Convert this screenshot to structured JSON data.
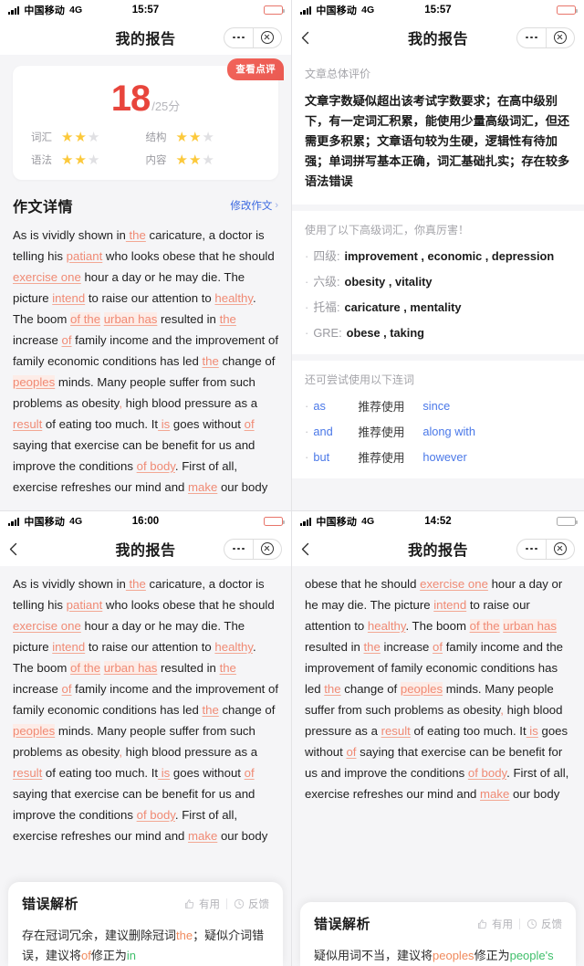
{
  "colors": {
    "accent_red": "#e8453c",
    "badge_red": "#ea5a52",
    "error_orange": "#f08a74",
    "link_blue": "#3d6ae0",
    "conj_blue": "#4a78e8",
    "star_gold": "#fcc93b",
    "suggest_green": "#3fbf6b",
    "page_bg": "#f5f5f7"
  },
  "status_bars": [
    {
      "carrier": "中国移动",
      "network": "4G",
      "time": "15:57",
      "battery_level": 62,
      "battery_low": true
    },
    {
      "carrier": "中国移动",
      "network": "4G",
      "time": "15:57",
      "battery_level": 62,
      "battery_low": true
    },
    {
      "carrier": "中国移动",
      "network": "4G",
      "time": "16:00",
      "battery_level": 55,
      "battery_low": true
    },
    {
      "carrier": "中国移动",
      "network": "4G",
      "time": "14:52",
      "battery_level": 45,
      "battery_low": false
    }
  ],
  "nav": {
    "title": "我的报告",
    "back_icon": "chevron-left-icon",
    "more_icon": "more-dots-icon",
    "close_icon": "close-circle-icon"
  },
  "score_card": {
    "badge": "查看点评",
    "score": "18",
    "total": "/25分",
    "ratings": [
      {
        "label": "词汇",
        "filled": 2,
        "max": 3
      },
      {
        "label": "结构",
        "filled": 2,
        "max": 3
      },
      {
        "label": "语法",
        "filled": 2,
        "max": 3
      },
      {
        "label": "内容",
        "filled": 2,
        "max": 3
      }
    ],
    "star_glyph": "★"
  },
  "detail": {
    "title": "作文详情",
    "modify_label": "修改作文",
    "chevron": "›"
  },
  "essay_segments_a": [
    {
      "t": "As is vividly shown in",
      "k": "n"
    },
    {
      "t": " the",
      "k": "e"
    },
    {
      "t": " caricature, a doctor is telling his ",
      "k": "n"
    },
    {
      "t": "patiant",
      "k": "e"
    },
    {
      "t": " who looks obese that he should ",
      "k": "n"
    },
    {
      "t": "exercise one",
      "k": "e"
    },
    {
      "t": " hour a day or he may die. The picture ",
      "k": "n"
    },
    {
      "t": "intend",
      "k": "e"
    },
    {
      "t": " to raise our attention to ",
      "k": "n"
    },
    {
      "t": "healthy",
      "k": "e"
    },
    {
      "t": ". The boom ",
      "k": "n"
    },
    {
      "t": "of the",
      "k": "eh"
    },
    {
      "t": " ",
      "k": "n"
    },
    {
      "t": "urban has",
      "k": "eh"
    },
    {
      "t": " resulted in ",
      "k": "n"
    },
    {
      "t": "the",
      "k": "e"
    },
    {
      "t": " increase ",
      "k": "n"
    },
    {
      "t": "of",
      "k": "e"
    },
    {
      "t": " family income and the improvement of family economic conditions has led ",
      "k": "n"
    },
    {
      "t": "the",
      "k": "e"
    },
    {
      "t": " change of ",
      "k": "n"
    },
    {
      "t": "peoples",
      "k": "eh"
    },
    {
      "t": " minds. Many people suffer from such problems as obesity",
      "k": "n"
    },
    {
      "t": ",",
      "k": "c"
    },
    {
      "t": " high blood pressure as a ",
      "k": "n"
    },
    {
      "t": "result",
      "k": "e"
    },
    {
      "t": " of eating too much. It",
      "k": "n"
    },
    {
      "t": " is",
      "k": "e"
    },
    {
      "t": " goes without ",
      "k": "n"
    },
    {
      "t": "of",
      "k": "e"
    },
    {
      "t": " saying that exercise can be benefit for us and improve the conditions ",
      "k": "n"
    },
    {
      "t": "of body",
      "k": "e"
    },
    {
      "t": ". First of all, exercise refreshes our mind and ",
      "k": "n"
    },
    {
      "t": "make",
      "k": "e"
    },
    {
      "t": " our body",
      "k": "n"
    }
  ],
  "essay_segments_b": [
    {
      "t": "obese that he should ",
      "k": "n"
    },
    {
      "t": "exercise one",
      "k": "e"
    },
    {
      "t": " hour a day or he may die. The picture ",
      "k": "n"
    },
    {
      "t": "intend",
      "k": "e"
    },
    {
      "t": " to raise our attention to ",
      "k": "n"
    },
    {
      "t": "healthy",
      "k": "e"
    },
    {
      "t": ". The boom ",
      "k": "n"
    },
    {
      "t": "of the",
      "k": "eh"
    },
    {
      "t": " ",
      "k": "n"
    },
    {
      "t": "urban has",
      "k": "eh"
    },
    {
      "t": " resulted in ",
      "k": "n"
    },
    {
      "t": "the",
      "k": "e"
    },
    {
      "t": " increase ",
      "k": "n"
    },
    {
      "t": "of",
      "k": "e"
    },
    {
      "t": " family income and the improvement of family economic conditions has led ",
      "k": "n"
    },
    {
      "t": "the",
      "k": "e"
    },
    {
      "t": " change of ",
      "k": "n"
    },
    {
      "t": "peoples",
      "k": "eh"
    },
    {
      "t": " minds. Many people suffer from such problems as obesity",
      "k": "n"
    },
    {
      "t": ",",
      "k": "c"
    },
    {
      "t": " high blood pressure as a ",
      "k": "n"
    },
    {
      "t": "result",
      "k": "e"
    },
    {
      "t": " of eating too much. It",
      "k": "n"
    },
    {
      "t": " is",
      "k": "e"
    },
    {
      "t": " goes without ",
      "k": "n"
    },
    {
      "t": "of",
      "k": "e"
    },
    {
      "t": " saying that exercise can be benefit for us and improve the conditions ",
      "k": "n"
    },
    {
      "t": "of body",
      "k": "e"
    },
    {
      "t": ". First of all, exercise refreshes our mind and ",
      "k": "n"
    },
    {
      "t": "make",
      "k": "e"
    },
    {
      "t": " our body",
      "k": "n"
    }
  ],
  "overall": {
    "label": "文章总体评价",
    "text": "文章字数疑似超出该考试字数要求；在高中级别下，有一定词汇积累，能使用少量高级词汇，但还需更多积累；文章语句较为生硬，逻辑性有待加强；单词拼写基本正确，词汇基础扎实；存在较多语法错误"
  },
  "vocabulary": {
    "label": "使用了以下高级词汇，你真厉害！",
    "items": [
      {
        "level": "四级:",
        "words": "improvement , economic , depression"
      },
      {
        "level": "六级:",
        "words": "obesity , vitality"
      },
      {
        "level": "托福:",
        "words": "caricature , mentality"
      },
      {
        "level": "GRE:",
        "words": "obese , taking"
      }
    ]
  },
  "conjunctions": {
    "label": "还可尝试使用以下连词",
    "items": [
      {
        "from": "as",
        "mid": "推荐使用",
        "to": "since"
      },
      {
        "from": "and",
        "mid": "推荐使用",
        "to": "along with"
      },
      {
        "from": "but",
        "mid": "推荐使用",
        "to": "however"
      }
    ]
  },
  "popup_left": {
    "title": "错误解析",
    "useful_label": "有用",
    "feedback_label": "反馈",
    "useful_icon": "thumbs-up-icon",
    "feedback_icon": "clock-icon",
    "segments": [
      {
        "t": "存在冠词冗余，建议删除冠词",
        "k": "n"
      },
      {
        "t": "the",
        "k": "o"
      },
      {
        "t": "；疑似介词错误，建议将",
        "k": "n"
      },
      {
        "t": "of",
        "k": "o"
      },
      {
        "t": "修正为",
        "k": "n"
      },
      {
        "t": "in",
        "k": "g"
      }
    ]
  },
  "popup_right": {
    "title": "错误解析",
    "useful_label": "有用",
    "feedback_label": "反馈",
    "useful_icon": "thumbs-up-icon",
    "feedback_icon": "clock-icon",
    "segments": [
      {
        "t": "疑似用词不当，建议将",
        "k": "n"
      },
      {
        "t": "peoples",
        "k": "o"
      },
      {
        "t": "修正",
        "k": "n"
      },
      {
        "t": "为",
        "k": "n"
      },
      {
        "t": "people's",
        "k": "g"
      }
    ]
  }
}
